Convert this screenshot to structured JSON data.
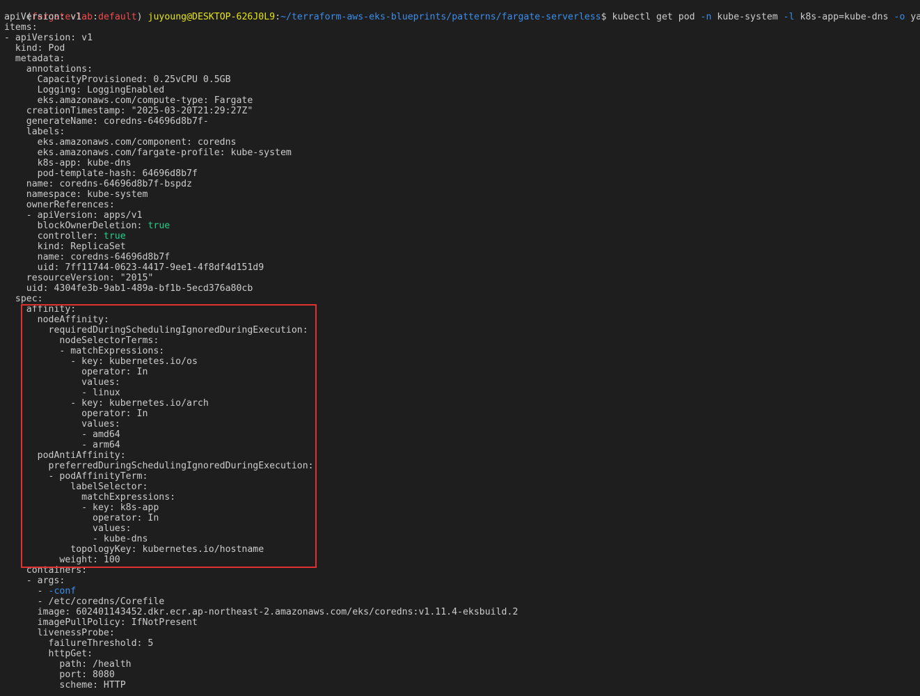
{
  "colors": {
    "background": "#1e1e1e",
    "text": "#cccccc",
    "prompt_env": "#f14c4c",
    "prompt_user": "#e5e510",
    "prompt_path": "#3b8eea",
    "boolean_value": "#23d18b",
    "flag": "#3b8eea",
    "highlight_box": "#e03030"
  },
  "prompt": {
    "open": "(",
    "env": "fargate-lab",
    "sep": ":",
    "profile": "default",
    "close": ")",
    "user_host": "juyoung@DESKTOP-626J0L9",
    "colon": ":",
    "path": "~/terraform-aws-eks-blueprints/patterns/fargate-serverless",
    "dollar": "$",
    "cmd1": "kubectl get pod",
    "flag_n": "-n",
    "arg_n": "kube-system",
    "flag_l": "-l",
    "arg_l": "k8s-app=kube-dns",
    "flag_o": "-o",
    "arg_o": "yaml"
  },
  "lines": [
    {
      "t": "apiVersion: v1"
    },
    {
      "t": "items:"
    },
    {
      "t": "- apiVersion: v1"
    },
    {
      "t": "  kind: Pod"
    },
    {
      "t": "  metadata:"
    },
    {
      "t": "    annotations:"
    },
    {
      "t": "      CapacityProvisioned: 0.25vCPU 0.5GB"
    },
    {
      "t": "      Logging: LoggingEnabled"
    },
    {
      "t": "      eks.amazonaws.com/compute-type: Fargate"
    },
    {
      "t": "    creationTimestamp: \"2025-03-20T21:29:27Z\""
    },
    {
      "t": "    generateName: coredns-64696d8b7f-"
    },
    {
      "t": "    labels:"
    },
    {
      "t": "      eks.amazonaws.com/component: coredns"
    },
    {
      "t": "      eks.amazonaws.com/fargate-profile: kube-system"
    },
    {
      "t": "      k8s-app: kube-dns"
    },
    {
      "t": "      pod-template-hash: 64696d8b7f"
    },
    {
      "t": "    name: coredns-64696d8b7f-bspdz"
    },
    {
      "t": "    namespace: kube-system"
    },
    {
      "t": "    ownerReferences:"
    },
    {
      "t": "    - apiVersion: apps/v1"
    },
    {
      "t": "      blockOwnerDeletion: ",
      "v": "true",
      "c": "c-green"
    },
    {
      "t": "      controller: ",
      "v": "true",
      "c": "c-green"
    },
    {
      "t": "      kind: ReplicaSet"
    },
    {
      "t": "      name: coredns-64696d8b7f"
    },
    {
      "t": "      uid: 7ff11744-0623-4417-9ee1-4f8df4d151d9"
    },
    {
      "t": "    resourceVersion: \"2015\""
    },
    {
      "t": "    uid: 4304fe3b-9ab1-489a-bf1b-5ecd376a80cb"
    },
    {
      "t": "  spec:"
    },
    {
      "t": "    affinity:"
    },
    {
      "t": "      nodeAffinity:"
    },
    {
      "t": "        requiredDuringSchedulingIgnoredDuringExecution:"
    },
    {
      "t": "          nodeSelectorTerms:"
    },
    {
      "t": "          - matchExpressions:"
    },
    {
      "t": "            - key: kubernetes.io/os"
    },
    {
      "t": "              operator: In"
    },
    {
      "t": "              values:"
    },
    {
      "t": "              - linux"
    },
    {
      "t": "            - key: kubernetes.io/arch"
    },
    {
      "t": "              operator: In"
    },
    {
      "t": "              values:"
    },
    {
      "t": "              - amd64"
    },
    {
      "t": "              - arm64"
    },
    {
      "t": "      podAntiAffinity:"
    },
    {
      "t": "        preferredDuringSchedulingIgnoredDuringExecution:"
    },
    {
      "t": "        - podAffinityTerm:"
    },
    {
      "t": "            labelSelector:"
    },
    {
      "t": "              matchExpressions:"
    },
    {
      "t": "              - key: k8s-app"
    },
    {
      "t": "                operator: In"
    },
    {
      "t": "                values:"
    },
    {
      "t": "                - kube-dns"
    },
    {
      "t": "            topologyKey: kubernetes.io/hostname"
    },
    {
      "t": "          weight: 100"
    },
    {
      "t": "    containers:"
    },
    {
      "t": "    - args:"
    },
    {
      "t": "      - ",
      "v": "-conf",
      "c": "c-blue"
    },
    {
      "t": "      - /etc/coredns/Corefile"
    },
    {
      "t": "      image: 602401143452.dkr.ecr.ap-northeast-2.amazonaws.com/eks/coredns:v1.11.4-eksbuild.2"
    },
    {
      "t": "      imagePullPolicy: IfNotPresent"
    },
    {
      "t": "      livenessProbe:"
    },
    {
      "t": "        failureThreshold: 5"
    },
    {
      "t": "        httpGet:"
    },
    {
      "t": "          path: /health"
    },
    {
      "t": "          port: 8080"
    },
    {
      "t": "          scheme: HTTP"
    }
  ]
}
